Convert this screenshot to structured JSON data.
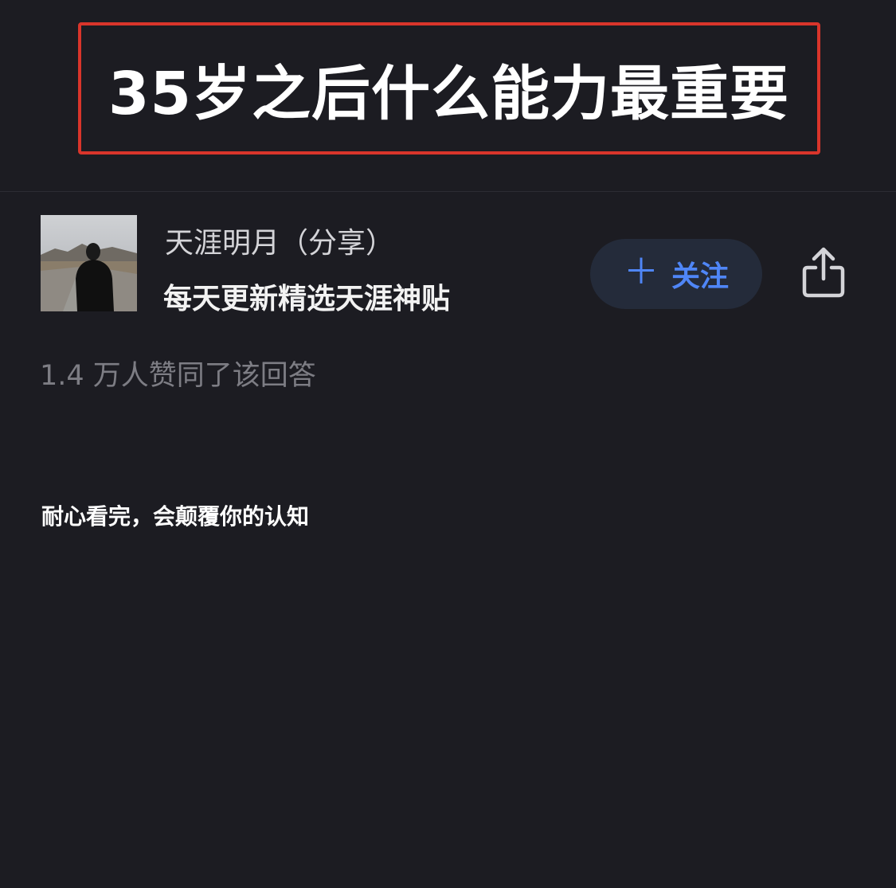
{
  "question": {
    "title": "35岁之后什么能力最重要"
  },
  "author": {
    "name": "天涯明月（分享）",
    "bio": "每天更新精选天涯神贴",
    "follow_label": "关注",
    "follow_icon": "plus-icon",
    "share_icon": "share-icon"
  },
  "answer": {
    "upvote_text": "1.4 万人赞同了该回答",
    "first_line": "耐心看完，会颠覆你的认知"
  },
  "colors": {
    "background": "#1c1c22",
    "title_border": "#d9352b",
    "accent": "#4f86f7",
    "follow_bg": "#242b3a",
    "muted_text": "#7d7d84"
  }
}
